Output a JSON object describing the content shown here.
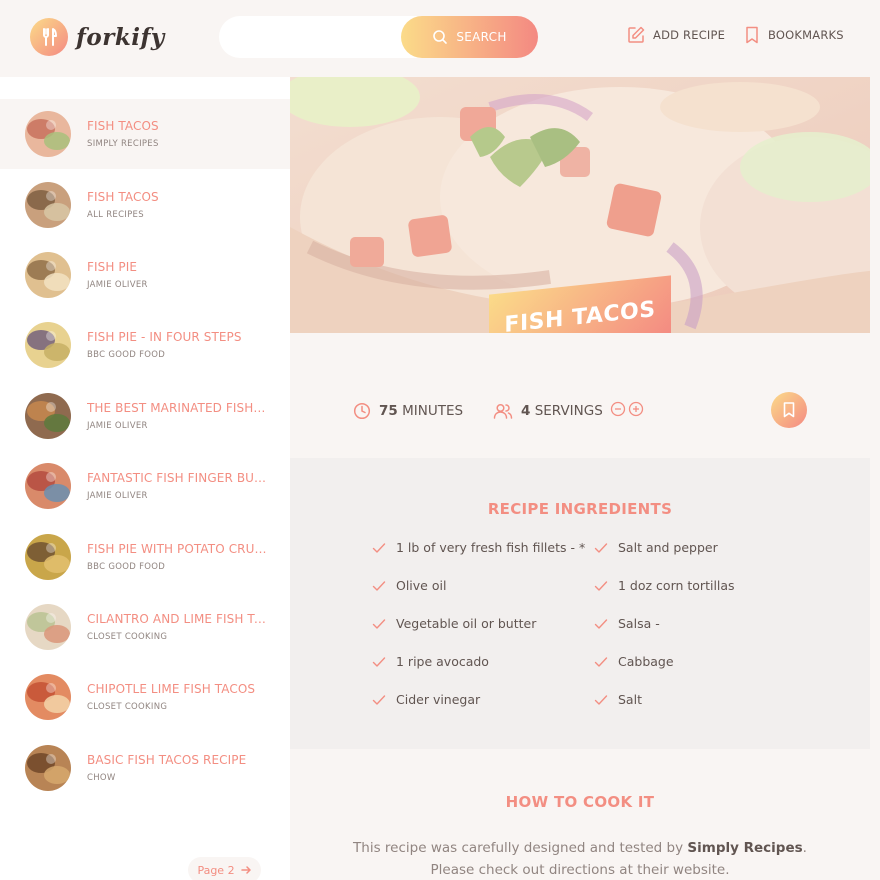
{
  "app": {
    "logo_text": "forkify"
  },
  "header": {
    "search_placeholder": "",
    "search_label": "SEARCH",
    "add_recipe_label": "ADD RECIPE",
    "bookmarks_label": "BOOKMARKS"
  },
  "results": [
    {
      "title": "FISH TACOS",
      "publisher": "SIMPLY RECIPES",
      "active": true
    },
    {
      "title": "FISH TACOS",
      "publisher": "ALL RECIPES"
    },
    {
      "title": "FISH PIE",
      "publisher": "JAMIE OLIVER"
    },
    {
      "title": "FISH PIE - IN FOUR STEPS",
      "publisher": "BBC GOOD FOOD"
    },
    {
      "title": "THE BEST MARINATED FISH K...",
      "publisher": "JAMIE OLIVER"
    },
    {
      "title": "FANTASTIC FISH FINGER BUTT...",
      "publisher": "JAMIE OLIVER"
    },
    {
      "title": "FISH PIE WITH POTATO CRUST",
      "publisher": "BBC GOOD FOOD"
    },
    {
      "title": "CILANTRO AND LIME FISH TA...",
      "publisher": "CLOSET COOKING"
    },
    {
      "title": "CHIPOTLE LIME FISH TACOS",
      "publisher": "CLOSET COOKING"
    },
    {
      "title": "BASIC FISH TACOS RECIPE",
      "publisher": "CHOW"
    }
  ],
  "pagination": {
    "next_label": "Page 2"
  },
  "recipe": {
    "title": "FISH TACOS",
    "minutes": "75",
    "minutes_label": "MINUTES",
    "servings": "4",
    "servings_label": "SERVINGS",
    "ingredients_title": "RECIPE INGREDIENTS",
    "ingredients": [
      "1 lb of very fresh fish fillets - *",
      "Olive oil",
      "Vegetable oil or butter",
      "1 ripe avocado",
      "Cider vinegar",
      "Salt and pepper",
      "1 doz corn tortillas",
      "Salsa -",
      "Cabbage",
      "Salt"
    ],
    "howto_title": "HOW TO COOK IT",
    "howto_text_1": "This recipe was carefully designed and tested by",
    "howto_publisher": "Simply Recipes",
    "howto_text_2": "Please check out directions at their website."
  },
  "colors": {
    "accent": "#f38e82",
    "gradient_start": "#fbdb89",
    "gradient_end": "#f48982"
  }
}
